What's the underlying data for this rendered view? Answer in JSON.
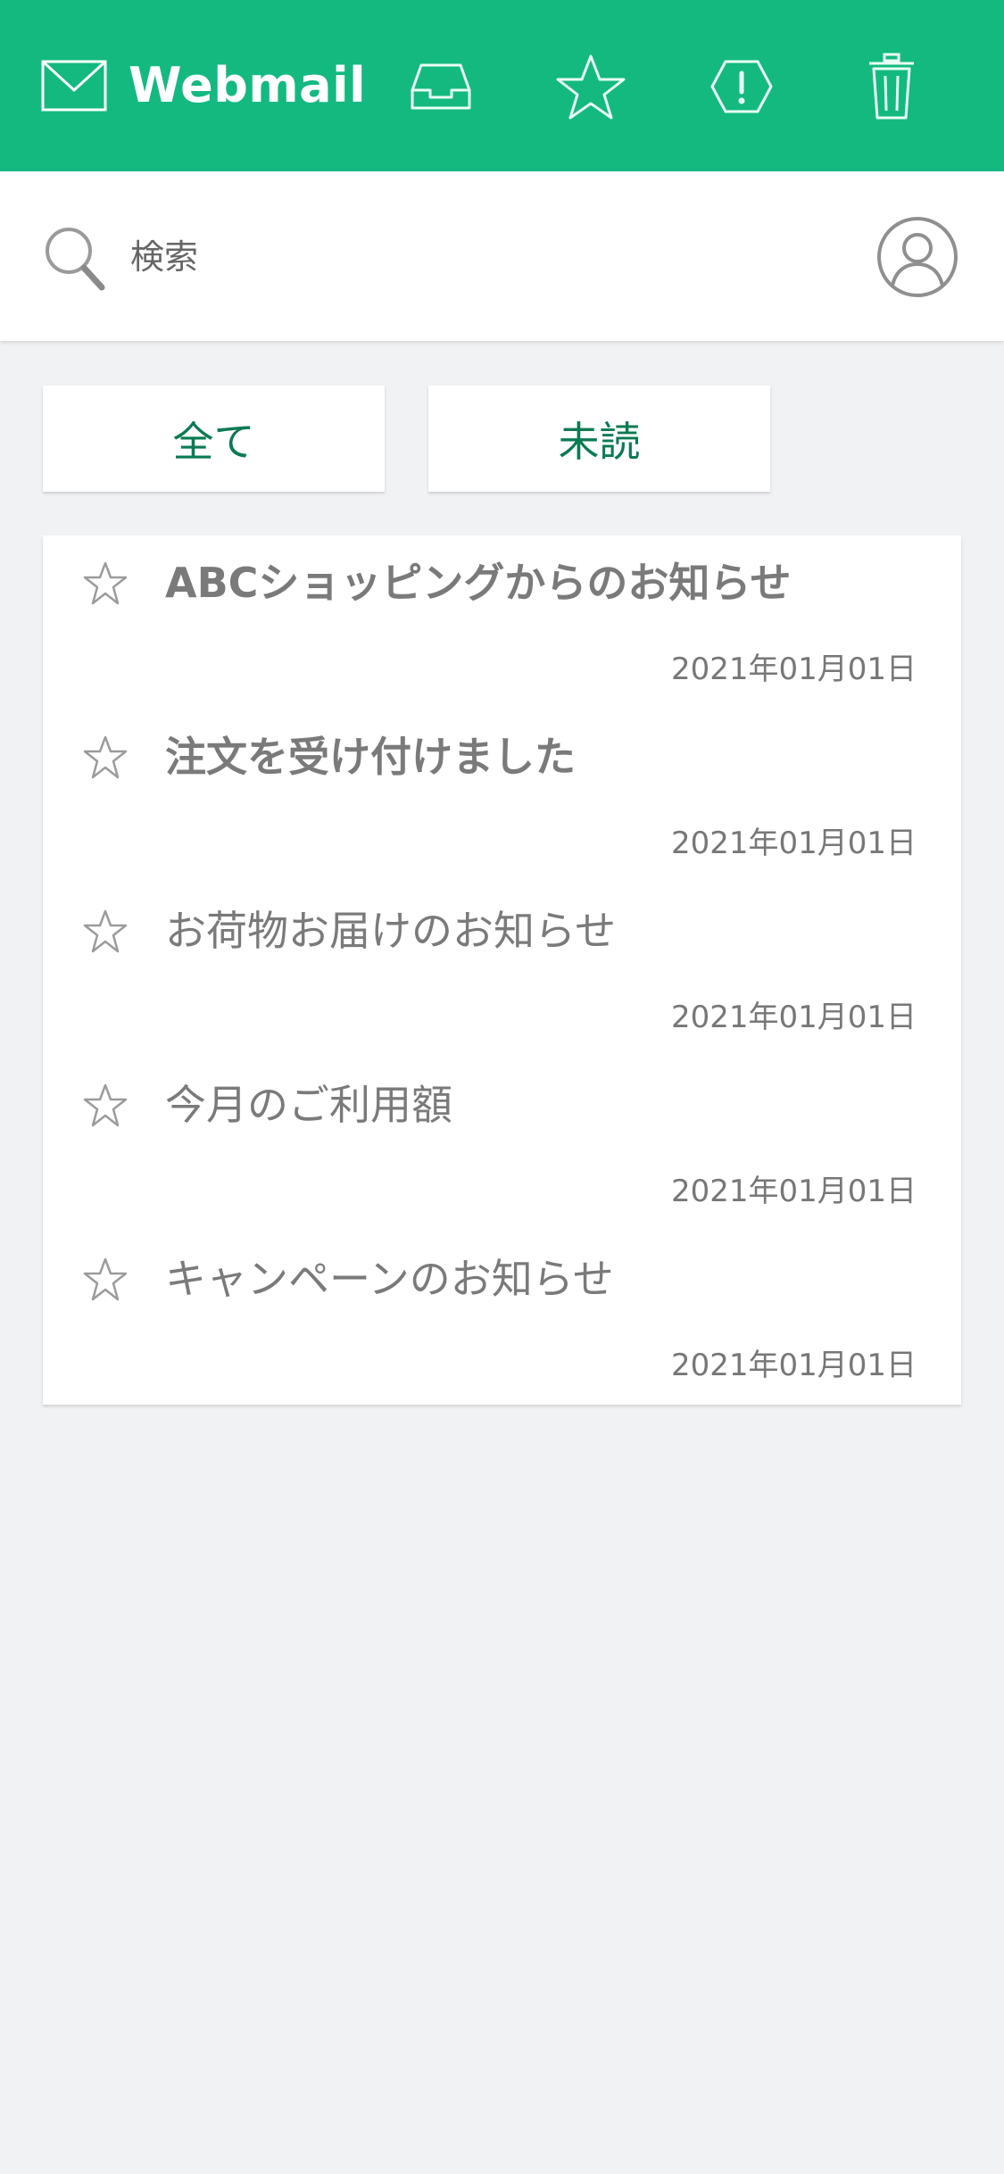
{
  "app": {
    "title": "Webmail",
    "accent_color": "#14b980",
    "header_icons": [
      "inbox-icon",
      "star-icon",
      "alert-icon",
      "trash-icon"
    ]
  },
  "search": {
    "placeholder": "検索",
    "value": ""
  },
  "filters": [
    {
      "label": "全て"
    },
    {
      "label": "未読"
    }
  ],
  "mails": [
    {
      "subject": "ABCショッピングからのお知らせ",
      "date": "2021年01月01日",
      "unread": true,
      "starred": false
    },
    {
      "subject": "注文を受け付けました",
      "date": "2021年01月01日",
      "unread": true,
      "starred": false
    },
    {
      "subject": "お荷物お届けのお知らせ",
      "date": "2021年01月01日",
      "unread": false,
      "starred": false
    },
    {
      "subject": "今月のご利用額",
      "date": "2021年01月01日",
      "unread": false,
      "starred": false
    },
    {
      "subject": "キャンペーンのお知らせ",
      "date": "2021年01月01日",
      "unread": false,
      "starred": false
    }
  ]
}
